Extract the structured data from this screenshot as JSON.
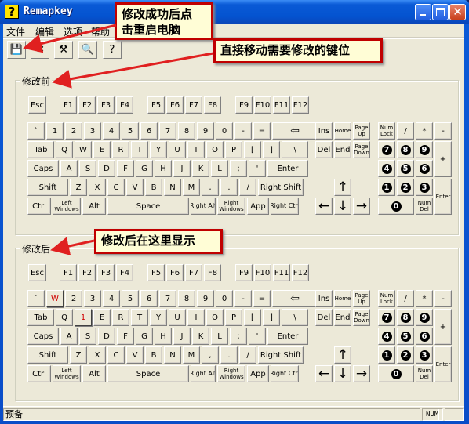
{
  "window": {
    "title": "Remapkey",
    "icon": "question-mark-icon",
    "buttons": [
      "minimize",
      "maximize",
      "close"
    ]
  },
  "menu": [
    "文件",
    "编辑",
    "选项",
    "帮助"
  ],
  "toolbar": {
    "tools": [
      {
        "name": "save-apply-icon",
        "glyph": "💾"
      },
      {
        "name": "cancel-remove-icon",
        "glyph": "✖"
      },
      {
        "name": "reset-hammer-icon",
        "glyph": "⚒"
      },
      {
        "name": "view-zoom-icon",
        "glyph": "🔍"
      },
      {
        "name": "help-icon",
        "glyph": "?"
      }
    ]
  },
  "groups": {
    "before": "修改前",
    "after": "修改后"
  },
  "keyboard_before": {
    "fn": [
      "Esc",
      "F1",
      "F2",
      "F3",
      "F4",
      "F5",
      "F6",
      "F7",
      "F8",
      "F9",
      "F10",
      "F11",
      "F12"
    ],
    "num": [
      "`",
      "1",
      "2",
      "3",
      "4",
      "5",
      "6",
      "7",
      "8",
      "9",
      "0",
      "-",
      "=",
      "⇦"
    ],
    "top": [
      "Tab",
      "Q",
      "W",
      "E",
      "R",
      "T",
      "Y",
      "U",
      "I",
      "O",
      "P",
      "[",
      "]",
      "\\"
    ],
    "home": [
      "Caps",
      "A",
      "S",
      "D",
      "F",
      "G",
      "H",
      "J",
      "K",
      "L",
      ";",
      "'",
      "Enter"
    ],
    "shift": [
      "Shift",
      "Z",
      "X",
      "C",
      "V",
      "B",
      "N",
      "M",
      ",",
      ".",
      "/",
      "Right Shift"
    ],
    "bottom": [
      "Ctrl",
      "Left Windows",
      "Alt",
      "Space",
      "Right Alt",
      "Right Windows",
      "App",
      "Right Ctrl"
    ]
  },
  "keyboard_after": {
    "fn": [
      "Esc",
      "F1",
      "F2",
      "F3",
      "F4",
      "F5",
      "F6",
      "F7",
      "F8",
      "F9",
      "F10",
      "F11",
      "F12"
    ],
    "num": [
      "`",
      "W",
      "2",
      "3",
      "4",
      "5",
      "6",
      "7",
      "8",
      "9",
      "0",
      "-",
      "=",
      "⇦"
    ],
    "top": [
      "Tab",
      "Q",
      "1",
      "E",
      "R",
      "T",
      "Y",
      "U",
      "I",
      "O",
      "P",
      "[",
      "]",
      "\\"
    ],
    "home": [
      "Caps",
      "A",
      "S",
      "D",
      "F",
      "G",
      "H",
      "J",
      "K",
      "L",
      ";",
      "'",
      "Enter"
    ],
    "shift": [
      "Shift",
      "Z",
      "X",
      "C",
      "V",
      "B",
      "N",
      "M",
      ",",
      ".",
      "/",
      "Right Shift"
    ],
    "bottom": [
      "Ctrl",
      "Left Windows",
      "Alt",
      "Space",
      "Right Alt",
      "Right Windows",
      "App",
      "Right Ctrl"
    ],
    "remapped": [
      "W",
      "1"
    ]
  },
  "nav": {
    "row1": [
      "Ins",
      "Home",
      "Page Up"
    ],
    "row2": [
      "Del",
      "End",
      "Page Down"
    ],
    "arrows": [
      "↑",
      "←",
      "↓",
      "→"
    ]
  },
  "numpad": {
    "row1": [
      "Num Lock",
      "/",
      "*",
      "-"
    ],
    "row2": [
      "7",
      "8",
      "9"
    ],
    "plus": "+",
    "row3": [
      "4",
      "5",
      "6"
    ],
    "row4": [
      "1",
      "2",
      "3"
    ],
    "enter": "Enter",
    "row5": [
      "0",
      "Num Del"
    ]
  },
  "status": {
    "text": "预备",
    "num": "NUM"
  },
  "callouts": {
    "restart": "修改成功后点\n击重启电脑",
    "drag": "直接移动需要修改的键位",
    "after": "修改后在这里显示"
  },
  "colors": {
    "callout_border": "#c00000",
    "callout_bg": "#fffdd6",
    "remapped_text": "#d00000"
  }
}
